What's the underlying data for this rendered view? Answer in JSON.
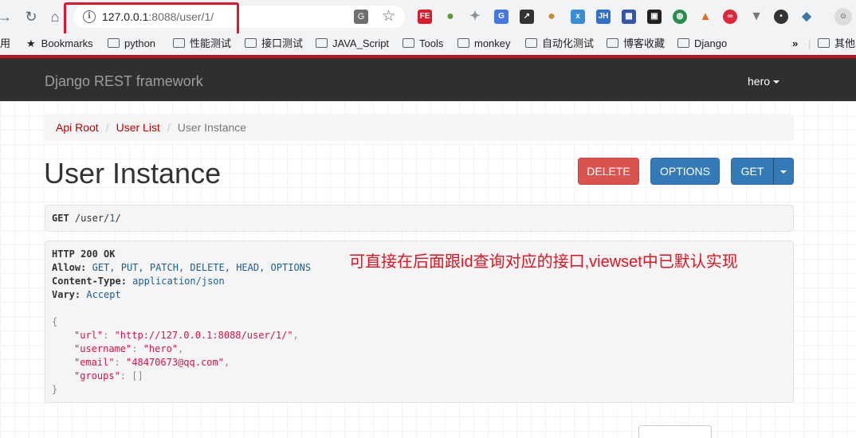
{
  "browser": {
    "url_host": "127.0.0.1",
    "url_rest": ":8088/user/1/",
    "bookmarks": [
      {
        "label": "用",
        "folder": false
      },
      {
        "label": "Bookmarks",
        "folder": false,
        "star": true
      },
      {
        "label": "python",
        "folder": true
      },
      {
        "label": "性能测试",
        "folder": true
      },
      {
        "label": "接口测试",
        "folder": true
      },
      {
        "label": "JAVA_Script",
        "folder": true
      },
      {
        "label": "Tools",
        "folder": true
      },
      {
        "label": "monkey",
        "folder": true
      },
      {
        "label": "自动化测试",
        "folder": true
      },
      {
        "label": "博客收藏",
        "folder": true
      },
      {
        "label": "Django",
        "folder": true
      }
    ],
    "more_label": "»",
    "other_label": "其他",
    "extensions": [
      "FE",
      "JH"
    ]
  },
  "navbar": {
    "brand": "Django REST framework",
    "user": "hero"
  },
  "breadcrumb": {
    "items": [
      "Api Root",
      "User List",
      "User Instance"
    ]
  },
  "page": {
    "title": "User Instance",
    "delete_label": "DELETE",
    "options_label": "OPTIONS",
    "get_label": "GET"
  },
  "request": {
    "method": "GET",
    "path_prefix": "/user/",
    "path_id": "1",
    "path_suffix": "/"
  },
  "response": {
    "status": "HTTP 200 OK",
    "allow_label": "Allow:",
    "allow_value": "GET, PUT, PATCH, DELETE, HEAD, OPTIONS",
    "content_type_label": "Content-Type:",
    "content_type_value": "application/json",
    "vary_label": "Vary:",
    "vary_value": "Accept",
    "open_brace": "{",
    "close_brace": "}",
    "fields": [
      {
        "key": "\"url\"",
        "value": "\"http://127.0.0.1:8088/user/1/\"",
        "comma": ","
      },
      {
        "key": "\"username\"",
        "value": "\"hero\"",
        "comma": ","
      },
      {
        "key": "\"email\"",
        "value": "\"48470673@qq.com\"",
        "comma": ","
      },
      {
        "key": "\"groups\"",
        "value": "[]",
        "comma": ""
      }
    ]
  },
  "annotation": "可直接在后面跟id查询对应的接口,viewset中已默认实现",
  "colors": {
    "delete": "#d9534f",
    "primary": "#337ab7",
    "navbar": "#2f2f2f",
    "annotation": "#e8101d",
    "highlight": "#e1162f"
  }
}
